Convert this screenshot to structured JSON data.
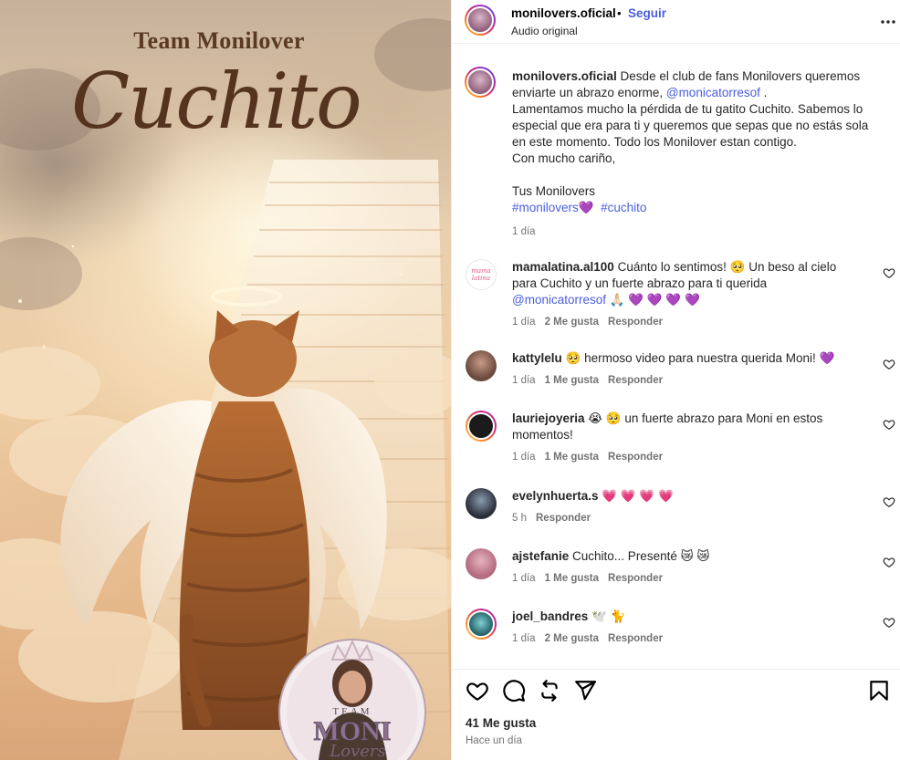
{
  "media": {
    "title_top": "Team Monilover",
    "title_main": "Cuchito",
    "badge_top": "TEAM",
    "badge_name": "MONI",
    "badge_sub": "Lovers"
  },
  "header": {
    "username": "monilovers.oficial",
    "separator": "•",
    "follow_label": "Seguir",
    "audio": "Audio original"
  },
  "caption": {
    "username": "monilovers.oficial",
    "text_1": " Desde el club de fans Monilovers queremos enviarte un abrazo enorme, ",
    "mention": "@monicatorresof",
    "text_2": " .",
    "line_2": "Lamentamos mucho la pérdida de tu gatito Cuchito. Sabemos lo especial que era para ti y queremos que sepas que no estás sola en este momento. Todo los Monilover estan contigo.",
    "line_3": "Con mucho cariño,",
    "line_4": "Tus Monilovers",
    "hashtag_1": "#monilovers💜",
    "hashtag_2": "#cuchito",
    "time": "1 día"
  },
  "comments": [
    {
      "username": "mamalatina.al100",
      "text": " Cuánto lo sentimos! 🥺 Un beso al cielo para Cuchito y un fuerte abrazo para ti querida ",
      "mention": "@monicatorresof",
      "text_after": " 🙏🏻 💜 💜 💜 💜",
      "time": "1 día",
      "likes": "2 Me gusta",
      "reply": "Responder",
      "avatar_color": "#ffffff"
    },
    {
      "username": "kattylelu",
      "text": " 🥺 hermoso video para nuestra querida Moni! 💜",
      "time": "1 día",
      "likes": "1 Me gusta",
      "reply": "Responder",
      "avatar_color": "#6b4a3e"
    },
    {
      "username": "lauriejoyeria",
      "text": " 😭 🥺 un fuerte abrazo para Moni en estos momentos!",
      "time": "1 día",
      "likes": "1 Me gusta",
      "reply": "Responder",
      "avatar_color": "#1b1b1b"
    },
    {
      "username": "evelynhuerta.s",
      "text": " 💗 💗 💗 💗",
      "time": "5 h",
      "likes": "",
      "reply": "Responder",
      "avatar_color": "#2a2f3a"
    },
    {
      "username": "ajstefanie",
      "text": " Cuchito... Presenté 😿 😿",
      "time": "1 día",
      "likes": "1 Me gusta",
      "reply": "Responder",
      "avatar_color": "#b36b7e"
    },
    {
      "username": "joel_bandres",
      "text": " 🕊️ 🐈",
      "time": "1 día",
      "likes": "2 Me gusta",
      "reply": "Responder",
      "avatar_color": "#2d6e74"
    }
  ],
  "footer": {
    "likes": "41 Me gusta",
    "time": "Hace un día"
  },
  "colors": {
    "link": "#4a5edb",
    "muted": "#737373",
    "text": "#262626"
  }
}
